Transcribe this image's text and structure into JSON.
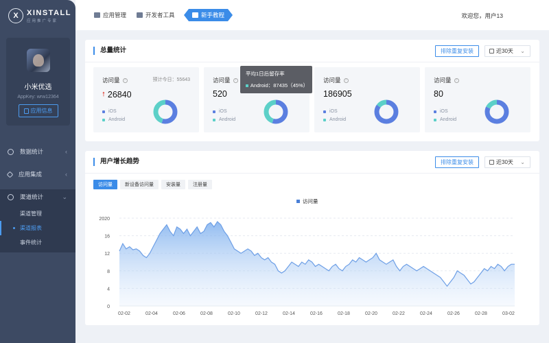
{
  "brand": {
    "name": "XINSTALL",
    "subtitle": "应用推广专家",
    "mark": "X"
  },
  "profile": {
    "name": "小米优选",
    "appkey": "AppKey: wrw12364",
    "button": "应用信息"
  },
  "menu": [
    {
      "label": "数据统计",
      "icon": "pie-chart-icon"
    },
    {
      "label": "应用集成",
      "icon": "integration-icon"
    },
    {
      "label": "渠道统计",
      "icon": "channel-icon"
    }
  ],
  "submenu": [
    "渠道管理",
    "渠道报表",
    "事件统计"
  ],
  "topnav": [
    {
      "label": "应用管理",
      "icon": "box-icon"
    },
    {
      "label": "开发者工具",
      "icon": "toolbox-icon"
    },
    {
      "label": "新手教程",
      "icon": "monitor-icon"
    }
  ],
  "welcome": "欢迎您，用户13",
  "summary": {
    "title": "总量统计",
    "button": "排除重复安装",
    "date_range": "近30天",
    "stats": [
      {
        "label": "访问量",
        "predict": "预计今日：55643",
        "value": "26840",
        "trend": "up",
        "ios_pct": 0.55,
        "android_pct": 0.45
      },
      {
        "label": "访问量",
        "predict": "",
        "value": "520",
        "trend": "",
        "ios_pct": 0.55,
        "android_pct": 0.45
      },
      {
        "label": "访问量",
        "predict": "",
        "value": "186905",
        "trend": "",
        "ios_pct": 0.85,
        "android_pct": 0.15
      },
      {
        "label": "访问量",
        "predict": "",
        "value": "80",
        "trend": "",
        "ios_pct": 0.82,
        "android_pct": 0.18
      }
    ],
    "legend": {
      "ios": "iOS",
      "android": "Android"
    },
    "tooltip": {
      "title": "平均1日后留存率",
      "line": "Android：87435（45%）"
    }
  },
  "trend": {
    "title": "用户增长趋势",
    "button": "排除重复安装",
    "date_range": "近30天",
    "tabs": [
      "访问量",
      "新设备访问量",
      "安装量",
      "注册量"
    ],
    "active_tab": 0
  },
  "colors": {
    "primary": "#3b8ce8",
    "ios": "#5b7fe0",
    "android": "#5cd0c8",
    "sidebar": "#3d4a63"
  },
  "chart_data": {
    "type": "area",
    "legend": [
      "访问量"
    ],
    "series": [
      {
        "name": "访问量",
        "values": [
          12.5,
          14.2,
          13.0,
          13.5,
          12.8,
          13.0,
          12.5,
          11.5,
          11.0,
          12.0,
          13.5,
          15.0,
          16.5,
          17.5,
          18.5,
          17.0,
          16.0,
          18.0,
          17.5,
          16.5,
          17.5,
          16.0,
          17.0,
          18.0,
          16.5,
          17.0,
          18.5,
          19.0,
          18.0,
          19.2,
          18.5,
          17.0,
          16.0,
          14.5,
          13.0,
          12.5,
          12.0,
          12.5,
          13.0,
          12.5,
          11.5,
          12.0,
          11.0,
          10.5,
          11.0,
          10.0,
          9.5,
          8.0,
          7.5,
          8.0,
          9.0,
          10.0,
          9.5,
          9.0,
          10.0,
          9.5,
          10.5,
          10.0,
          9.0,
          9.5,
          9.0,
          8.5,
          8.0,
          9.0,
          9.5,
          8.5,
          8.0,
          9.0,
          9.5,
          10.5,
          10.0,
          11.0,
          10.5,
          10.0,
          10.5,
          11.0,
          12.0,
          10.5,
          10.0,
          9.5,
          10.0,
          10.5,
          9.0,
          8.0,
          9.0,
          9.5,
          9.0,
          8.5,
          8.0,
          8.5,
          9.0,
          8.5,
          8.0,
          7.5,
          7.0,
          6.5,
          5.5,
          4.5,
          5.5,
          6.5,
          8.0,
          7.5,
          7.0,
          6.0,
          5.0,
          5.5,
          6.5,
          7.5,
          8.5,
          8.0,
          9.0,
          8.5,
          9.5,
          9.0,
          8.0,
          9.0,
          9.5,
          9.5
        ]
      }
    ],
    "x_ticks": [
      "02-02",
      "02-04",
      "02-06",
      "02-08",
      "02-10",
      "02-12",
      "02-14",
      "02-16",
      "02-18",
      "02-20",
      "02-22",
      "02-24",
      "02-26",
      "02-28",
      "03-02"
    ],
    "y_ticks": [
      "0",
      "4",
      "8",
      "12",
      "16",
      "2020"
    ],
    "ylim": [
      0,
      20
    ]
  }
}
